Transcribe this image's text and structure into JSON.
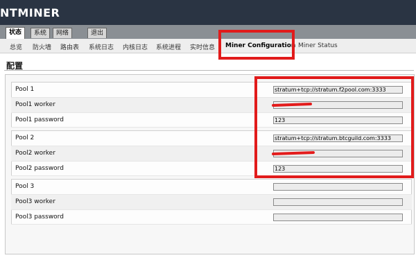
{
  "header": {
    "logo_bold": "NT",
    "logo_text": "MINER"
  },
  "tabs": [
    "状态",
    "系统",
    "网络",
    "退出"
  ],
  "subnav": [
    "总览",
    "防火墙",
    "路由表",
    "系统日志",
    "内核日志",
    "系统进程",
    "实时信息",
    "Miner Configuration",
    "Miner Status"
  ],
  "page": {
    "title": "配置"
  },
  "pools": [
    {
      "label": "Pool 1",
      "value": "stratum+tcp://stratum.f2pool.com:3333"
    },
    {
      "label": "Pool1 worker",
      "value": ""
    },
    {
      "label": "Pool1 password",
      "value": "123"
    },
    {
      "label": "Pool 2",
      "value": "stratum+tcp://stratum.btcguild.com:3333"
    },
    {
      "label": "Pool2 worker",
      "value": ""
    },
    {
      "label": "Pool2 password",
      "value": "123"
    },
    {
      "label": "Pool 3",
      "value": ""
    },
    {
      "label": "Pool3 worker",
      "value": ""
    },
    {
      "label": "Pool3 password",
      "value": ""
    }
  ],
  "colors": {
    "header_bg": "#2a3443",
    "highlight": "#e11b1b"
  }
}
